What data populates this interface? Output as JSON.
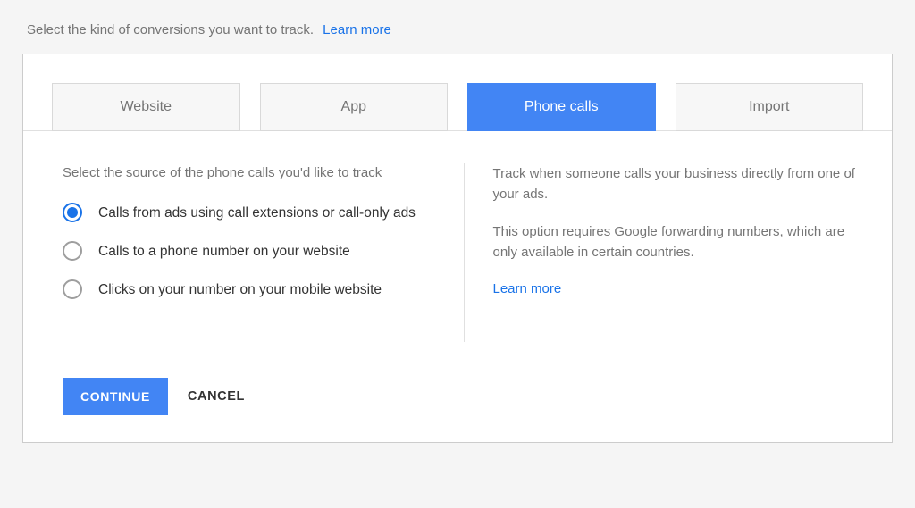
{
  "intro": {
    "text": "Select the kind of conversions you want to track.",
    "learn_more": "Learn more"
  },
  "tabs": [
    {
      "label": "Website",
      "active": false
    },
    {
      "label": "App",
      "active": false
    },
    {
      "label": "Phone calls",
      "active": true
    },
    {
      "label": "Import",
      "active": false
    }
  ],
  "left": {
    "prompt": "Select the source of the phone calls you'd like to track",
    "options": [
      {
        "label": "Calls from ads using call extensions or call-only ads",
        "selected": true
      },
      {
        "label": "Calls to a phone number on your website",
        "selected": false
      },
      {
        "label": "Clicks on your number on your mobile website",
        "selected": false
      }
    ]
  },
  "right": {
    "description1": "Track when someone calls your business directly from one of your ads.",
    "description2": "This option requires Google forwarding numbers, which are only available in certain countries.",
    "learn_more": "Learn more"
  },
  "actions": {
    "continue": "CONTINUE",
    "cancel": "CANCEL"
  }
}
